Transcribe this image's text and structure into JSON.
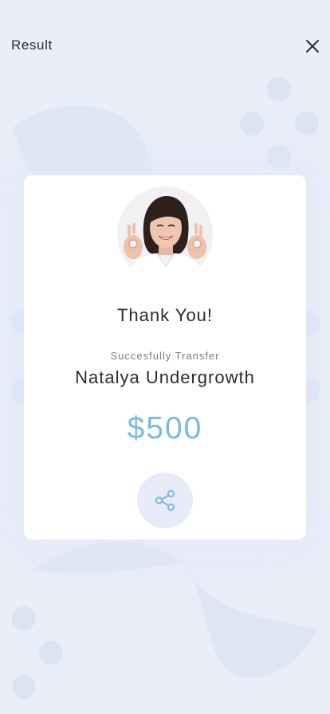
{
  "header": {
    "title": "Result",
    "close_icon": "close-icon"
  },
  "card": {
    "avatar_icon": "avatar-photo",
    "thanks_text": "Thank You!",
    "subtitle": "Succesfully Transfer",
    "recipient": "Natalya Undergrowth",
    "amount": "$500",
    "share_icon": "share-icon"
  },
  "colors": {
    "background": "#eaeef8",
    "accent": "#7ab9e1",
    "share_button_bg": "#e6ebf7",
    "card": "#ffffff"
  }
}
